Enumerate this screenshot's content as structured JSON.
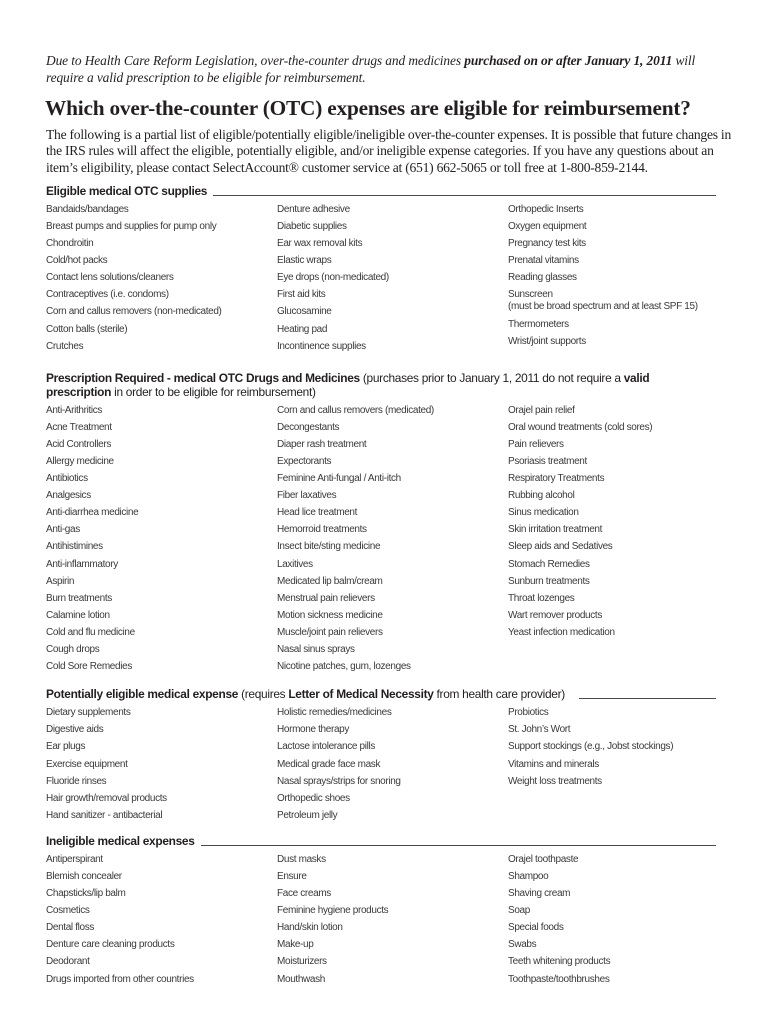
{
  "notice": {
    "text_before": "Due to Health Care Reform Legislation, over-the-counter drugs and medicines ",
    "bold": "purchased on or after January 1, 2011",
    "text_after": " will require a valid prescription to be eligible for reimbursement."
  },
  "title": "Which over-the-counter (OTC) expenses are eligible for reimbursement?",
  "intro": "The following is a partial list of eligible/potentially eligible/ineligible over-the-counter expenses. It is possible that future changes in the IRS rules will affect the eligible, potentially eligible, and/or ineligible expense categories. If you have any questions about an item’s eligibility, please contact SelectAccount® customer service at (651) 662-5065 or toll free at 1-800-859-2144.",
  "sections": {
    "eligible": {
      "heading": "Eligible medical OTC supplies",
      "columns": [
        [
          "Bandaids/bandages",
          "Breast pumps and supplies for pump only",
          "Chondroitin",
          "Cold/hot packs",
          "Contact lens solutions/cleaners",
          "Contraceptives (i.e. condoms)",
          "Corn and callus removers (non-medicated)",
          "Cotton balls (sterile)",
          "Crutches"
        ],
        [
          "Denture adhesive",
          "Diabetic supplies",
          "Ear wax removal kits",
          "Elastic wraps",
          "Eye drops (non-medicated)",
          "First aid kits",
          "Glucosamine",
          "Heating pad",
          "Incontinence supplies"
        ],
        [
          "Orthopedic Inserts",
          "Oxygen equipment",
          "Pregnancy test kits",
          "Prenatal vitamins",
          "Reading glasses",
          "Sunscreen",
          "Thermometers",
          "Wrist/joint supports"
        ]
      ],
      "sunscreen_note": "(must be broad spectrum and at least SPF 15)"
    },
    "prescription": {
      "heading_bold": "Prescription Required - medical OTC Drugs and Medicines",
      "heading_note_1": " (purchases prior to January 1, 2011 do not require a ",
      "heading_bold_2": "valid prescription",
      "heading_note_2": " in order to be eligible for reimbursement)",
      "columns": [
        [
          "Anti-Arithritics",
          "Acne Treatment",
          "Acid Controllers",
          "Allergy medicine",
          "Antibiotics",
          "Analgesics",
          "Anti-diarrhea medicine",
          "Anti-gas",
          "Antihistimines",
          "Anti-inflammatory",
          "Aspirin",
          "Burn treatments",
          "Calamine lotion",
          "Cold and flu medicine",
          "Cough drops",
          "Cold Sore Remedies"
        ],
        [
          "Corn and callus removers (medicated)",
          "Decongestants",
          "Diaper rash treatment",
          "Expectorants",
          "Feminine Anti-fungal / Anti-itch",
          "Fiber laxatives",
          "Head lice treatment",
          "Hemorroid treatments",
          "Insect bite/sting medicine",
          "Laxitives",
          "Medicated lip balm/cream",
          "Menstrual pain relievers",
          "Motion sickness medicine",
          "Muscle/joint pain relievers",
          "Nasal sinus sprays",
          "Nicotine patches, gum, lozenges"
        ],
        [
          "Orajel pain relief",
          "Oral wound treatments (cold sores)",
          "Pain relievers",
          "Psoriasis treatment",
          "Respiratory Treatments",
          "Rubbing alcohol",
          "Sinus medication",
          "Skin irritation treatment",
          "Sleep aids and Sedatives",
          "Stomach Remedies",
          "Sunburn treatments",
          "Throat lozenges",
          "Wart remover products",
          "Yeast infection medication"
        ]
      ]
    },
    "potential": {
      "heading_bold": "Potentially eligible medical expense",
      "heading_note_1": " (requires ",
      "heading_bold_2": "Letter of Medical Necessity",
      "heading_note_2": " from health care provider)",
      "columns": [
        [
          "Dietary supplements",
          "Digestive aids",
          "Ear plugs",
          "Exercise equipment",
          "Fluoride rinses",
          "Hair growth/removal products",
          "Hand sanitizer - antibacterial"
        ],
        [
          "Holistic remedies/medicines",
          "Hormone therapy",
          "Lactose intolerance pills",
          "Medical grade face mask",
          "Nasal sprays/strips for snoring",
          "Orthopedic shoes",
          "Petroleum jelly"
        ],
        [
          "Probiotics",
          "St. John’s Wort",
          "Support stockings (e.g., Jobst stockings)",
          "Vitamins and minerals",
          "Weight loss treatments"
        ]
      ]
    },
    "ineligible": {
      "heading": "Ineligible medical expenses",
      "columns": [
        [
          "Antiperspirant",
          "Blemish concealer",
          "Chapsticks/lip balm",
          "Cosmetics",
          "Dental floss",
          "Denture care cleaning products",
          "Deodorant",
          "Drugs imported from other countries"
        ],
        [
          "Dust masks",
          "Ensure",
          "Face creams",
          "Feminine hygiene products",
          "Hand/skin lotion",
          "Make-up",
          "Moisturizers",
          "Mouthwash"
        ],
        [
          "Orajel toothpaste",
          "Shampoo",
          "Shaving cream",
          "Soap",
          "Special foods",
          "Swabs",
          "Teeth whitening products",
          "Toothpaste/toothbrushes"
        ]
      ]
    }
  }
}
